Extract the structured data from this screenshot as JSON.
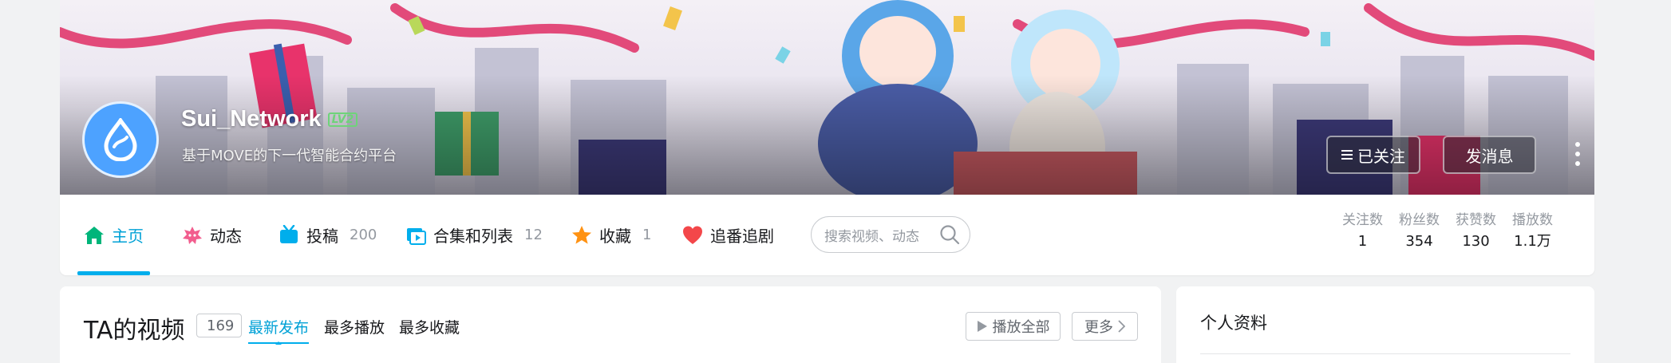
{
  "header": {
    "username": "Sui_Network",
    "level": "LV2",
    "bio": "基于MOVE的下一代智能合约平台",
    "follow_button": "已关注",
    "message_button": "发消息"
  },
  "nav": {
    "tabs": [
      {
        "label": "主页",
        "count": ""
      },
      {
        "label": "动态",
        "count": ""
      },
      {
        "label": "投稿",
        "count": "200"
      },
      {
        "label": "合集和列表",
        "count": "12"
      },
      {
        "label": "收藏",
        "count": "1"
      },
      {
        "label": "追番追剧",
        "count": ""
      }
    ],
    "search_placeholder": "搜索视频、动态"
  },
  "stats": [
    {
      "label": "关注数",
      "value": "1"
    },
    {
      "label": "粉丝数",
      "value": "354"
    },
    {
      "label": "获赞数",
      "value": "130"
    },
    {
      "label": "播放数",
      "value": "1.1万"
    }
  ],
  "videos": {
    "title": "TA的视频",
    "count": "169",
    "sort_tabs": [
      "最新发布",
      "最多播放",
      "最多收藏"
    ],
    "play_all": "播放全部",
    "more": "更多"
  },
  "profile": {
    "title": "个人资料"
  },
  "colors": {
    "accent": "#00aeec",
    "home_green": "#00b57a",
    "avatar_blue": "#4da2ff"
  }
}
